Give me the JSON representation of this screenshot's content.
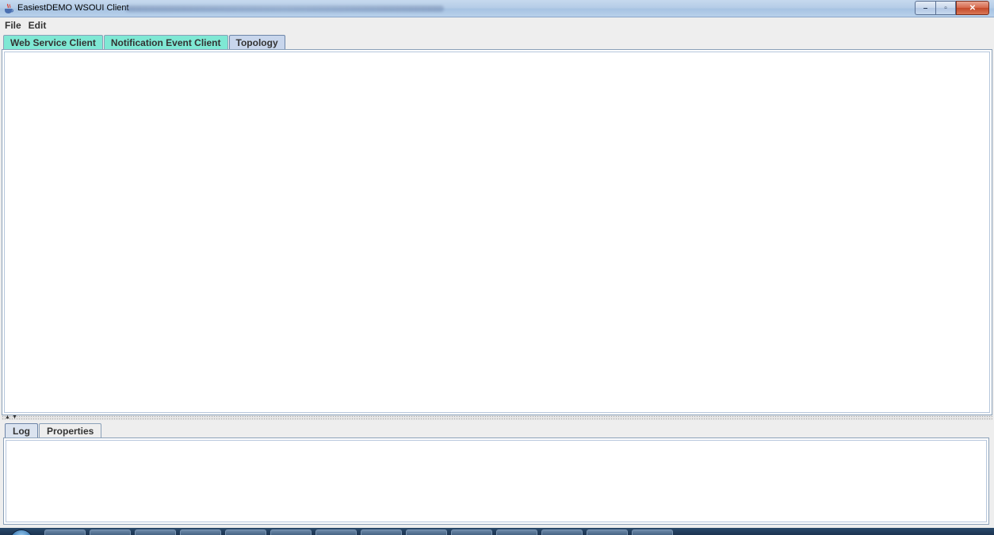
{
  "window": {
    "title": "EasiestDEMO WSOUI Client",
    "icon": "java-cup-icon"
  },
  "window_buttons": {
    "minimize_icon": "minimize-icon",
    "maximize_icon": "restore-icon",
    "close_icon": "close-icon",
    "minimize_label": "–",
    "maximize_label": "▫",
    "close_label": "✕"
  },
  "menubar": {
    "items": [
      "File",
      "Edit"
    ]
  },
  "top_tabs": [
    {
      "label": "Web Service Client",
      "selected": false
    },
    {
      "label": "Notification Event Client",
      "selected": false
    },
    {
      "label": "Topology",
      "selected": true
    }
  ],
  "splitter": {
    "up_arrow": "▲",
    "down_arrow": "▼"
  },
  "bottom_tabs": [
    {
      "label": "Log",
      "selected": true
    },
    {
      "label": "Properties",
      "selected": false
    }
  ],
  "colors": {
    "tab_cyan": "#7fe8d4",
    "tab_selected": "#c8d6ec",
    "close_red": "#c44a2b"
  }
}
